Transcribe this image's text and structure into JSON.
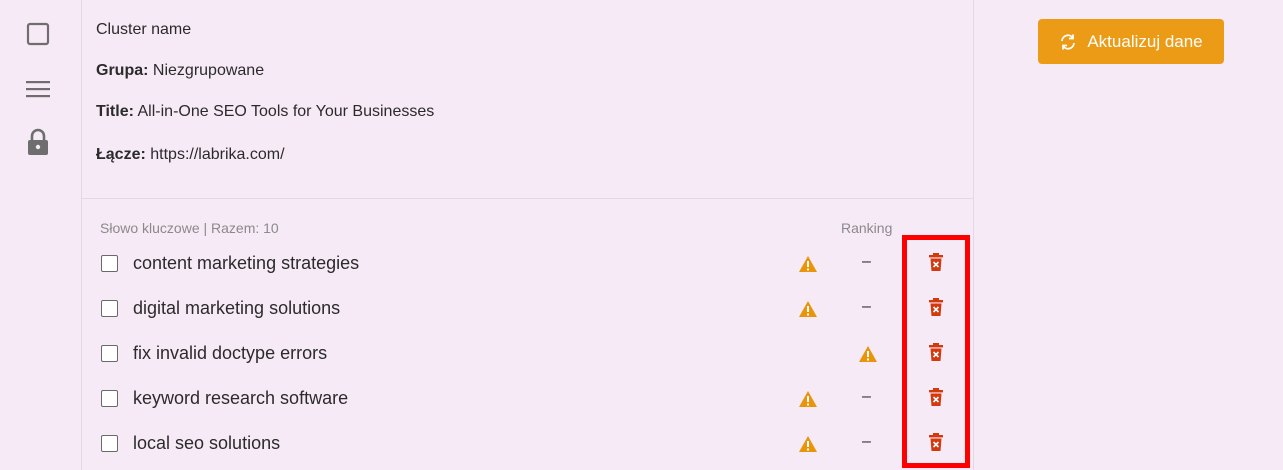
{
  "info": {
    "cluster_name": "Cluster name",
    "group_label": "Grupa:",
    "group_value": "Niezgrupowane",
    "title_label": "Title:",
    "title_value": "All-in-One SEO Tools for Your Businesses",
    "link_label": "Łącze:",
    "link_value": "https://labrika.com/"
  },
  "keywords_table": {
    "header_keywords": "Słowo kluczowe | Razem: 10",
    "header_ranking": "Ranking",
    "rows": [
      {
        "keyword": "content marketing strategies",
        "ranking": "–"
      },
      {
        "keyword": "digital marketing solutions",
        "ranking": "–"
      },
      {
        "keyword": "fix invalid doctype errors",
        "ranking": ""
      },
      {
        "keyword": "keyword research software",
        "ranking": "–"
      },
      {
        "keyword": "local seo solutions",
        "ranking": "–"
      }
    ]
  },
  "actions": {
    "update_label": "Aktualizuj dane"
  },
  "icons": {
    "rail": [
      "square-icon",
      "menu-icon",
      "lock-icon"
    ],
    "row": [
      "warning-icon",
      "trash-icon"
    ],
    "button": "refresh-icon"
  },
  "colors": {
    "background": "#f7eaf7",
    "accent": "#eb9b15",
    "warning": "#e8950c",
    "delete": "#d4380d",
    "highlight": "#ff0000"
  }
}
